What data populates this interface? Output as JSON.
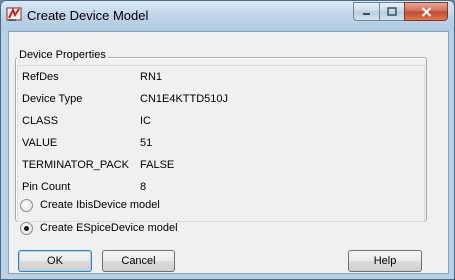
{
  "window": {
    "title": "Create Device Model"
  },
  "group": {
    "title": "Device Properties"
  },
  "properties": [
    {
      "key": "RefDes",
      "value": "RN1"
    },
    {
      "key": "Device Type",
      "value": "CN1E4KTTD510J"
    },
    {
      "key": "CLASS",
      "value": "IC"
    },
    {
      "key": "VALUE",
      "value": "51"
    },
    {
      "key": "TERMINATOR_PACK",
      "value": "FALSE"
    },
    {
      "key": "Pin Count",
      "value": "8"
    }
  ],
  "options": {
    "ibis_label": "Create IbisDevice model",
    "espice_label": "Create ESpiceDevice model",
    "selected": "espice"
  },
  "buttons": {
    "ok": "OK",
    "cancel": "Cancel",
    "help": "Help"
  },
  "colors": {
    "title_bar": "#bcd3e8",
    "close_button": "#c0482c",
    "dialog_bg": "#f0f0f0"
  }
}
